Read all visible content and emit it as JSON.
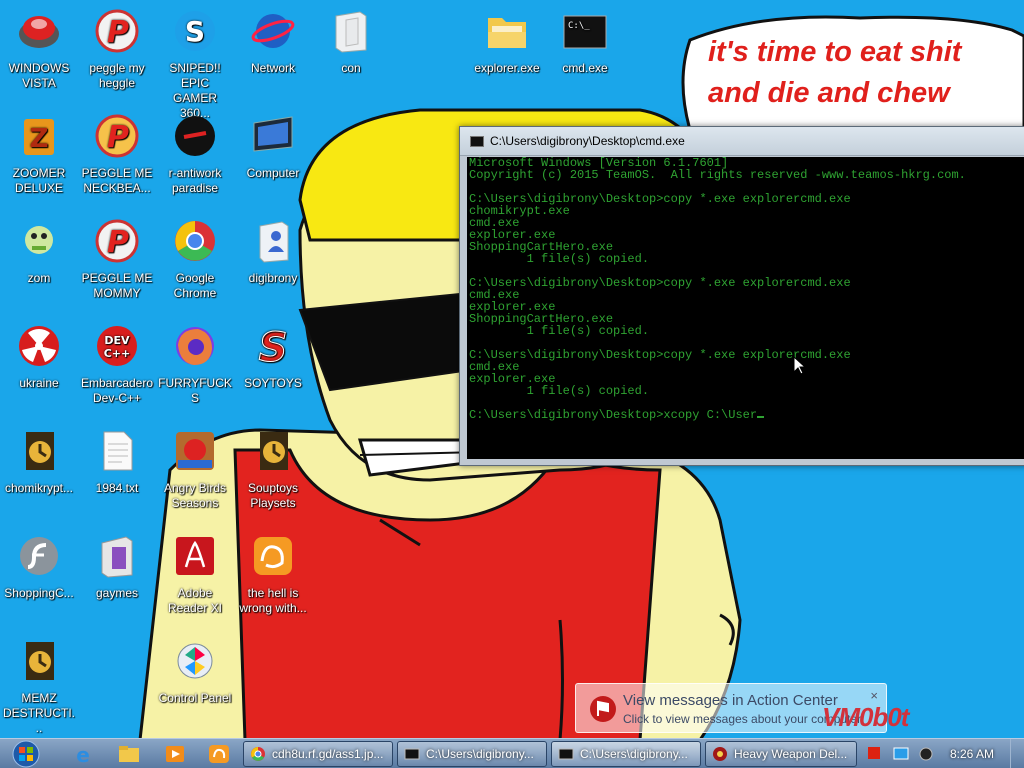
{
  "wallpaper": {
    "speech_text": "it's time to eat shit\nand die and chew"
  },
  "desktop_icons": [
    {
      "label": "WINDOWS VISTA",
      "icon": "windows-vista-icon"
    },
    {
      "label": "peggle my heggle",
      "icon": "peggle-icon"
    },
    {
      "label": "SNIPED!! EPIC GAMER 360...",
      "icon": "skype-icon"
    },
    {
      "label": "Network",
      "icon": "network-icon"
    },
    {
      "label": "con",
      "icon": "folder-icon"
    },
    {
      "label": "explorer.exe",
      "icon": "folder-explorer-icon"
    },
    {
      "label": "cmd.exe",
      "icon": "cmd-icon"
    },
    {
      "label": "ZOOMER DELUXE",
      "icon": "zoomer-icon"
    },
    {
      "label": "PEGGLE ME NECKBEA...",
      "icon": "peggle-icon"
    },
    {
      "label": "r-antiwork paradise",
      "icon": "antiwork-icon"
    },
    {
      "label": "Computer",
      "icon": "computer-icon"
    },
    {
      "label": "zom",
      "icon": "zom-icon"
    },
    {
      "label": "PEGGLE ME MOMMY",
      "icon": "peggle-icon"
    },
    {
      "label": "Google Chrome",
      "icon": "chrome-icon"
    },
    {
      "label": "digibrony",
      "icon": "user-folder-icon"
    },
    {
      "label": "ukraine",
      "icon": "radiation-icon"
    },
    {
      "label": "Embarcadero Dev-C++",
      "icon": "devcpp-icon"
    },
    {
      "label": "FURRYFUCKS",
      "icon": "firefox-icon"
    },
    {
      "label": "SOYTOYS",
      "icon": "soytoys-icon"
    },
    {
      "label": "chomikrypt...",
      "icon": "memz-icon"
    },
    {
      "label": "1984.txt",
      "icon": "text-file-icon"
    },
    {
      "label": "Angry Birds Seasons",
      "icon": "angry-birds-icon"
    },
    {
      "label": "Souptoys Playsets",
      "icon": "memz-icon"
    },
    {
      "label": "ShoppingC...",
      "icon": "flash-icon"
    },
    {
      "label": "gaymes",
      "icon": "games-folder-icon"
    },
    {
      "label": "Adobe Reader XI",
      "icon": "adobe-reader-icon"
    },
    {
      "label": "the hell is wrong with...",
      "icon": "uc-browser-icon"
    },
    {
      "label": "MEMZ DESTRUCTI...",
      "icon": "memz-icon"
    },
    {
      "label": "Control Panel",
      "icon": "control-panel-icon"
    }
  ],
  "cmd": {
    "title": "C:\\Users\\digibrony\\Desktop\\cmd.exe",
    "lines": [
      "Microsoft Windows [Version 6.1.7601]",
      "Copyright (c) 2015 TeamOS.  All rights reserved -www.teamos-hkrg.com.",
      "",
      "C:\\Users\\digibrony\\Desktop>copy *.exe explorercmd.exe",
      "chomikrypt.exe",
      "cmd.exe",
      "explorer.exe",
      "ShoppingCartHero.exe",
      "        1 file(s) copied.",
      "",
      "C:\\Users\\digibrony\\Desktop>copy *.exe explorercmd.exe",
      "cmd.exe",
      "explorer.exe",
      "ShoppingCartHero.exe",
      "        1 file(s) copied.",
      "",
      "C:\\Users\\digibrony\\Desktop>copy *.exe explorercmd.exe",
      "cmd.exe",
      "explorer.exe",
      "        1 file(s) copied.",
      "",
      "C:\\Users\\digibrony\\Desktop>xcopy C:\\User"
    ]
  },
  "notification": {
    "title": "View messages in Action Center",
    "body": "Click to view messages about your computer.",
    "close": "×"
  },
  "watermark": "VM0b0t",
  "taskbar": {
    "tasks": [
      {
        "label": "cdh8u.rf.gd/ass1.jp...",
        "icon": "chrome-icon",
        "active": false
      },
      {
        "label": "C:\\Users\\digibrony...",
        "icon": "cmd-icon",
        "active": false
      },
      {
        "label": "C:\\Users\\digibrony...",
        "icon": "cmd-icon",
        "active": true
      },
      {
        "label": "Heavy Weapon Del...",
        "icon": "heavy-weapon-icon",
        "active": false
      }
    ],
    "clock": "8:26 AM"
  },
  "colors": {
    "desktop_bg": "#1aa6ea",
    "console_text": "#2fa332",
    "speech_text": "#e0201c"
  }
}
